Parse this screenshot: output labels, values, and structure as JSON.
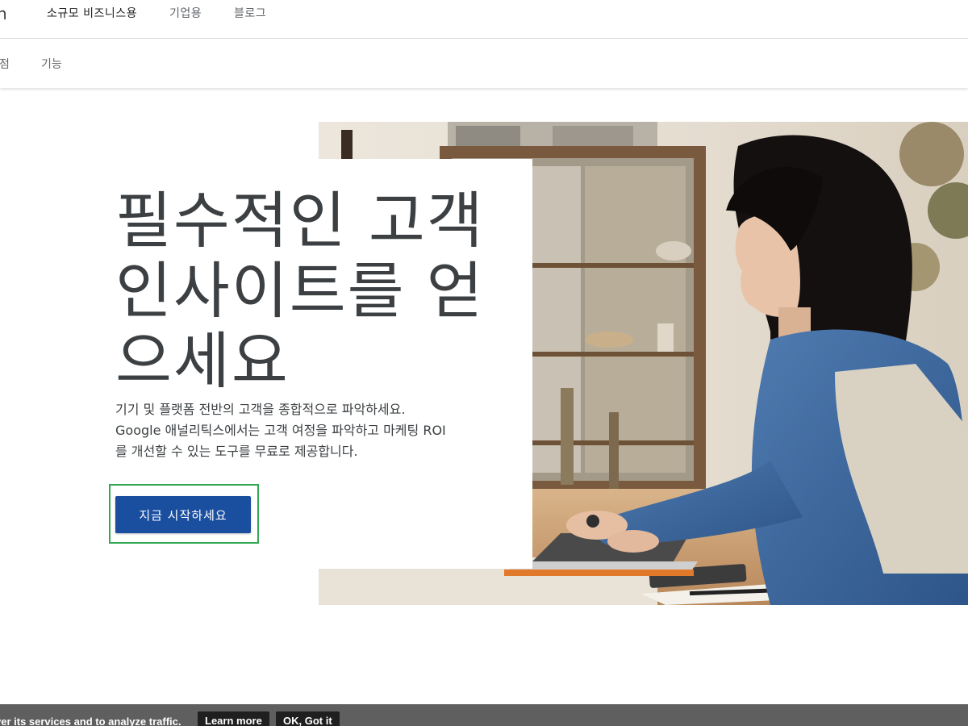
{
  "topnav": {
    "cut_left_glyph": "n",
    "items": [
      "소규모 비즈니스용",
      "기업용",
      "블로그"
    ]
  },
  "subnav": {
    "items": [
      "점",
      "기능"
    ]
  },
  "hero": {
    "title_lines": [
      "필수적인 고객",
      "인사이트를 얻",
      "으세요"
    ],
    "description_lines": [
      "기기 및 플랫폼 전반의 고객을 종합적으로 파악하세요.",
      "Google 애널리틱스에서는 고객 여정을 파악하고 마케팅 ROI",
      "를 개선할 수 있는 도구를 무료로 제공합니다."
    ],
    "cta_label": "지금 시작하세요"
  },
  "cookie_bar": {
    "text": "ver its services and to analyze traffic.",
    "learn_more": "Learn more",
    "ok": "OK, Got it"
  },
  "colors": {
    "cta_blue": "#1a4fa0",
    "highlight_green": "#34a853",
    "cookie_bg": "#5f5f5f"
  }
}
